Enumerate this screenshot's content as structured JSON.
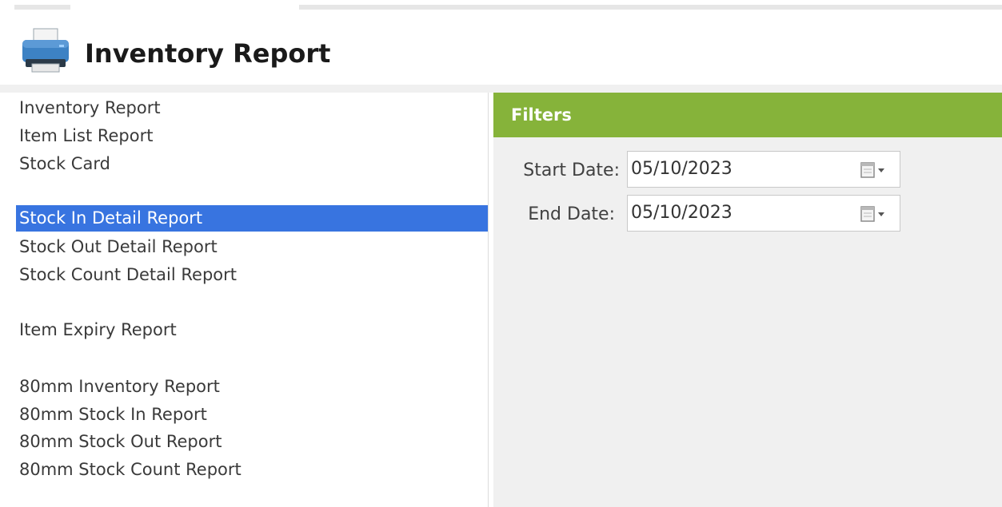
{
  "header": {
    "title": "Inventory Report",
    "icon": "printer-icon"
  },
  "report_list": {
    "selected_index": 3,
    "selection_color": "#3874e0",
    "items": [
      {
        "label": "Inventory Report"
      },
      {
        "label": "Item List Report"
      },
      {
        "label": "Stock Card"
      },
      {
        "label": "Stock In Detail Report"
      },
      {
        "label": "Stock Out Detail Report"
      },
      {
        "label": "Stock Count Detail Report"
      },
      {
        "label": "Item Expiry Report"
      },
      {
        "label": "80mm Inventory Report"
      },
      {
        "label": "80mm Stock In Report"
      },
      {
        "label": "80mm Stock Out Report"
      },
      {
        "label": "80mm Stock Count Report"
      }
    ]
  },
  "filters": {
    "title": "Filters",
    "header_color": "#86b33a",
    "start_date": {
      "label": "Start Date:",
      "value": "05/10/2023",
      "icon": "calendar-dropdown-icon"
    },
    "end_date": {
      "label": "End Date:",
      "value": "05/10/2023",
      "icon": "calendar-dropdown-icon"
    }
  }
}
